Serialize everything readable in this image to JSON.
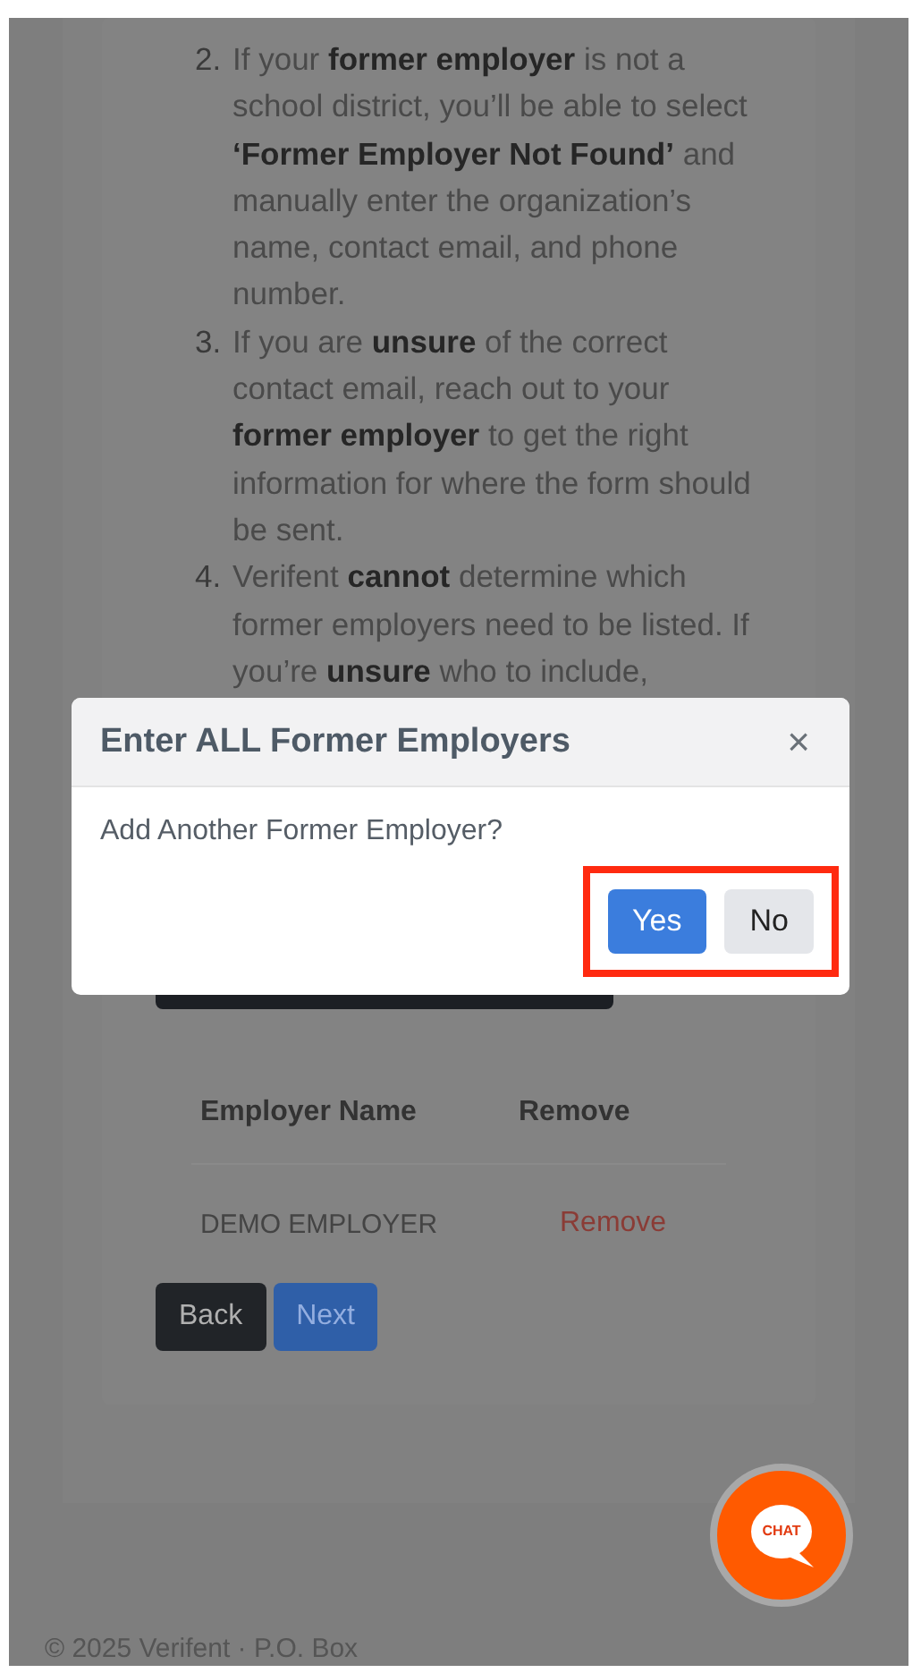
{
  "instructions": [
    {
      "number": "2.",
      "text": "If your **former employer** is not a school district, you’ll be able to select **‘Former Employer Not Found’** and manually enter the organization’s name, contact email, and phone number."
    },
    {
      "number": "3.",
      "text": "If you are **unsure** of the correct contact email, reach out to your **former employer** to get the right information for where the form should be sent."
    },
    {
      "number": "4.",
      "text": "Verifent **cannot** determine which former employers need to be listed. If you’re **unsure** who to include,"
    }
  ],
  "table": {
    "columns": [
      "Employer Name",
      "Remove"
    ],
    "rows": [
      {
        "name": "DEMO EMPLOYER",
        "action": "Remove"
      }
    ]
  },
  "nav_buttons": [
    {
      "label": "Back",
      "kind": "secondary"
    },
    {
      "label": "Next",
      "kind": "primary"
    }
  ],
  "modal": {
    "title": "Enter ALL Former Employers",
    "close": "×",
    "message": "Add Another Former Employer?",
    "buttons": [
      {
        "label": "Yes",
        "kind": "primary"
      },
      {
        "label": "No",
        "kind": "secondary"
      }
    ],
    "highlighted": true
  },
  "chat": {
    "label": "CHAT"
  },
  "footer": "© 2025 Verifent · P.O. Box"
}
